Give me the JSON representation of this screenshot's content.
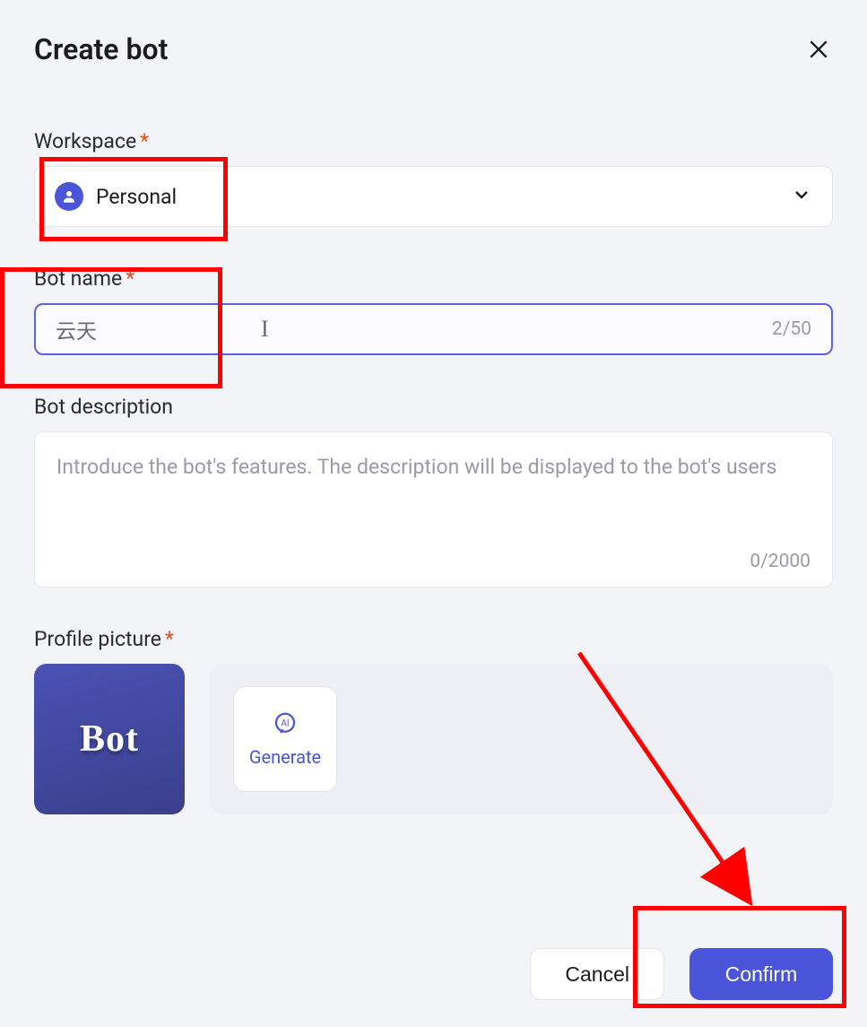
{
  "modal": {
    "title": "Create bot"
  },
  "workspace": {
    "label": "Workspace",
    "selected": "Personal"
  },
  "botname": {
    "label": "Bot name",
    "value": "云天",
    "counter": "2/50"
  },
  "description": {
    "label": "Bot description",
    "placeholder": "Introduce the bot's features. The description will be displayed to the bot's users",
    "counter": "0/2000"
  },
  "picture": {
    "label": "Profile picture",
    "tile_text": "Bot",
    "generate": "Generate"
  },
  "footer": {
    "cancel": "Cancel",
    "confirm": "Confirm"
  }
}
